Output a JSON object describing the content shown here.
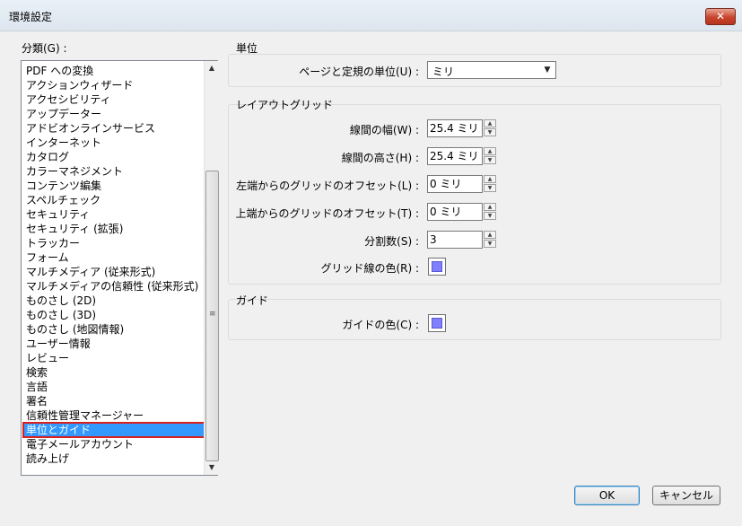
{
  "window": {
    "title": "環境設定",
    "close_label": "✕"
  },
  "categories": {
    "label": "分類(G) :",
    "items": [
      "PDF への変換",
      "アクションウィザード",
      "アクセシビリティ",
      "アップデーター",
      "アドビオンラインサービス",
      "インターネット",
      "カタログ",
      "カラーマネジメント",
      "コンテンツ編集",
      "スペルチェック",
      "セキュリティ",
      "セキュリティ (拡張)",
      "トラッカー",
      "フォーム",
      "マルチメディア (従来形式)",
      "マルチメディアの信頼性 (従来形式)",
      "ものさし (2D)",
      "ものさし (3D)",
      "ものさし (地図情報)",
      "ユーザー情報",
      "レビュー",
      "検索",
      "言語",
      "署名",
      "信頼性管理マネージャー",
      "単位とガイド",
      "電子メールアカウント",
      "読み上げ"
    ],
    "selected": "単位とガイド"
  },
  "units": {
    "title": "単位",
    "page_unit_label": "ページと定規の単位(U) :",
    "page_unit_value": "ミリ"
  },
  "grid": {
    "title": "レイアウトグリッド",
    "width_label": "線間の幅(W) :",
    "width_value": "25.4 ミリ",
    "height_label": "線間の高さ(H) :",
    "height_value": "25.4 ミリ",
    "left_offset_label": "左端からのグリッドのオフセット(L) :",
    "left_offset_value": "0 ミリ",
    "top_offset_label": "上端からのグリッドのオフセット(T) :",
    "top_offset_value": "0 ミリ",
    "subdivisions_label": "分割数(S) :",
    "subdivisions_value": "3",
    "color_label": "グリッド線の色(R) :",
    "color": "#8080ff"
  },
  "guides": {
    "title": "ガイド",
    "color_label": "ガイドの色(C) :",
    "color": "#8080ff"
  },
  "buttons": {
    "ok": "OK",
    "cancel": "キャンセル"
  },
  "icons": {
    "scroll_up": "triangle-up-icon",
    "scroll_down": "triangle-down-icon",
    "dropdown": "chevron-down-icon"
  }
}
